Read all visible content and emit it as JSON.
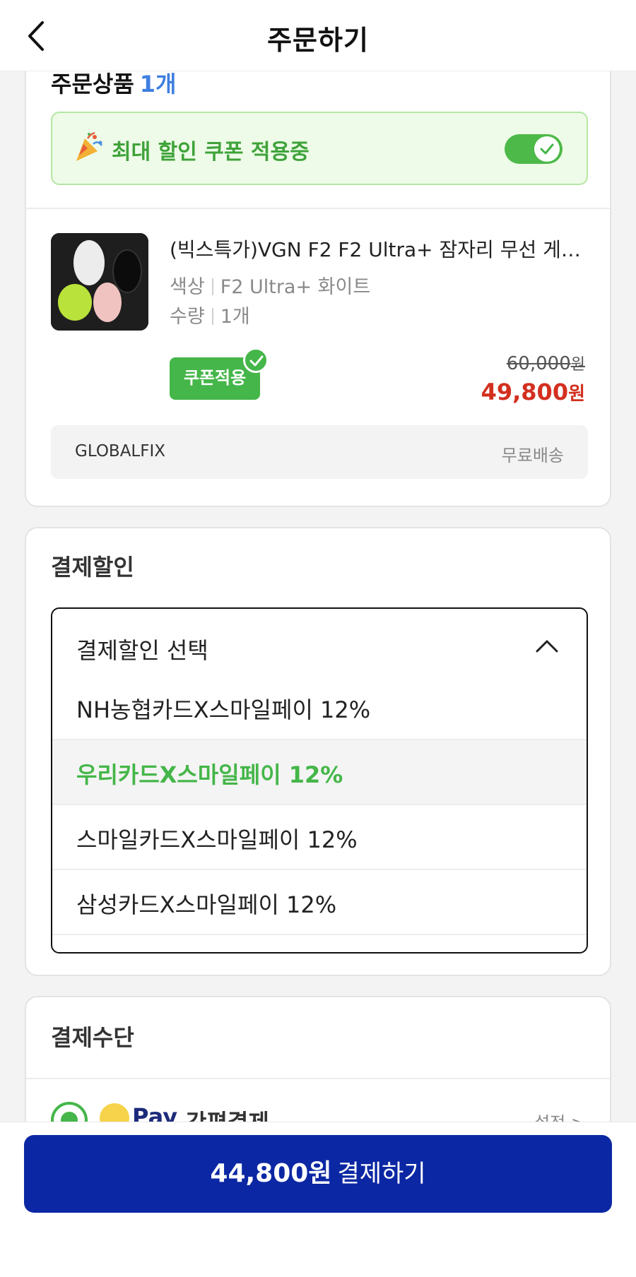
{
  "header": {
    "title": "주문하기"
  },
  "order": {
    "count_label": "주문상품",
    "count_value": "1개",
    "coupon_banner_text": "최대 할인 쿠폰 적용중",
    "coupon_toggle_on": true
  },
  "product": {
    "name": "(빅스특가)VGN F2 F2 Ultra+ 잠자리 무선 게이…",
    "color_label": "색상",
    "color_value": "F2 Ultra+ 화이트",
    "qty_label": "수량",
    "qty_value": "1개",
    "coupon_badge": "쿠폰적용",
    "original_price": "60,000",
    "sale_price": "49,800",
    "currency": "원",
    "seller": "GLOBALFIX",
    "shipping": "무료배송"
  },
  "payment_discount": {
    "title": "결제할인",
    "select_label": "결제할인 선택",
    "options": [
      {
        "label": "NH농협카드X스마일페이 12%",
        "selected": false
      },
      {
        "label": "우리카드X스마일페이 12%",
        "selected": true
      },
      {
        "label": "스마일카드X스마일페이 12%",
        "selected": false
      },
      {
        "label": "삼성카드X스마일페이 12%",
        "selected": false
      }
    ]
  },
  "payment_method": {
    "title": "결제수단",
    "pay_logo": "Pay",
    "pay_label": "간편결제",
    "setting": "설정 >"
  },
  "checkout": {
    "amount": "44,800원",
    "label": "결제하기"
  },
  "colors": {
    "accent_green": "#45b649",
    "sale_red": "#d32f1f",
    "button_blue": "#0b27a3",
    "count_blue": "#3f7fe0"
  }
}
